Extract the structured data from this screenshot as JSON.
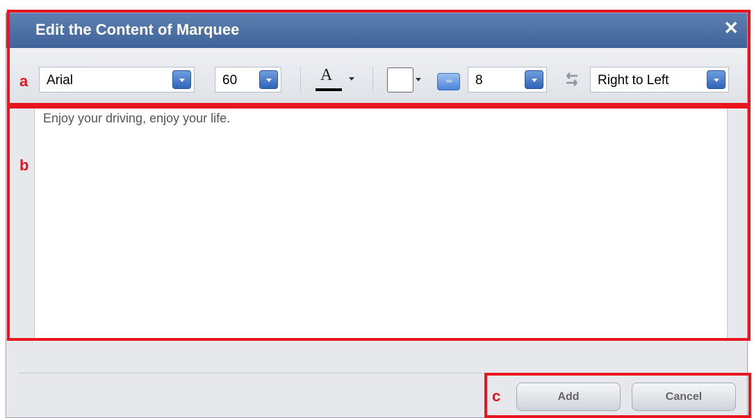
{
  "dialog": {
    "title": "Edit the Content of Marquee",
    "close_symbol": "✕"
  },
  "toolbar": {
    "font_family": "Arial",
    "font_size": "60",
    "font_color_letter": "A",
    "font_color": "#000000",
    "background_color": "#ffffff",
    "speed": "8",
    "direction": "Right to Left"
  },
  "editor": {
    "content": "Enjoy your driving, enjoy your life."
  },
  "buttons": {
    "add_label": "Add",
    "cancel_label": "Cancel"
  },
  "annotations": {
    "a": "a",
    "b": "b",
    "c": "c",
    "color": "#e8141e"
  },
  "icons": {
    "close": "close-icon",
    "dropdown": "chevron-down-icon",
    "speed": "speed-icon",
    "direction": "swap-arrows-icon"
  }
}
